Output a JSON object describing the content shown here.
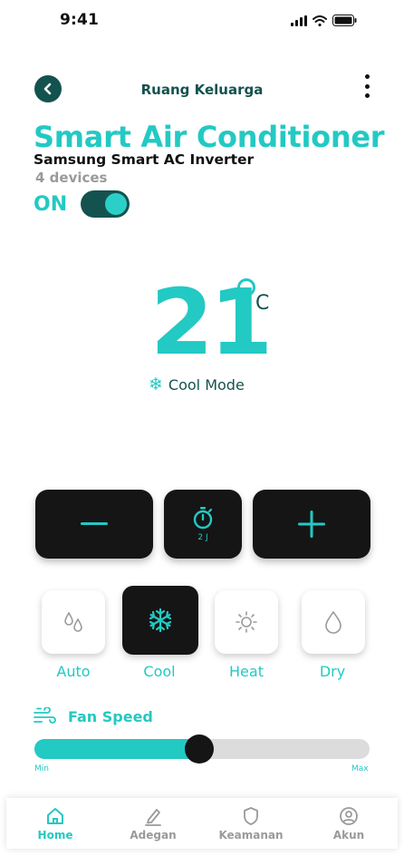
{
  "status_bar": {
    "time": "9:41"
  },
  "header": {
    "title": "Ruang Keluarga"
  },
  "device": {
    "name": "Smart Air Conditioner",
    "model": "Samsung Smart AC Inverter",
    "count": "4 devices",
    "power_label": "ON",
    "power_on": true
  },
  "temperature": {
    "value": "21",
    "unit": "C",
    "mode_label": "Cool Mode"
  },
  "controls": {
    "timer_label": "2 J"
  },
  "modes": [
    {
      "label": "Auto",
      "icon": "droplets-icon",
      "active": false
    },
    {
      "label": "Cool",
      "icon": "snowflake-icon",
      "active": true
    },
    {
      "label": "Heat",
      "icon": "sun-icon",
      "active": false
    },
    {
      "label": "Dry",
      "icon": "drop-icon",
      "active": false
    }
  ],
  "fan_speed": {
    "label": "Fan Speed",
    "level": 0.49,
    "min_label": "Min",
    "max_label": "Max"
  },
  "bottom_nav": [
    {
      "label": "Home",
      "icon": "home-icon",
      "active": true
    },
    {
      "label": "Adegan",
      "icon": "edit-icon",
      "active": false
    },
    {
      "label": "Keamanan",
      "icon": "shield-icon",
      "active": false
    },
    {
      "label": "Akun",
      "icon": "user-icon",
      "active": false
    }
  ],
  "colors": {
    "accent": "#23c9c3",
    "dark_teal": "#14524f",
    "dark": "#151515"
  }
}
